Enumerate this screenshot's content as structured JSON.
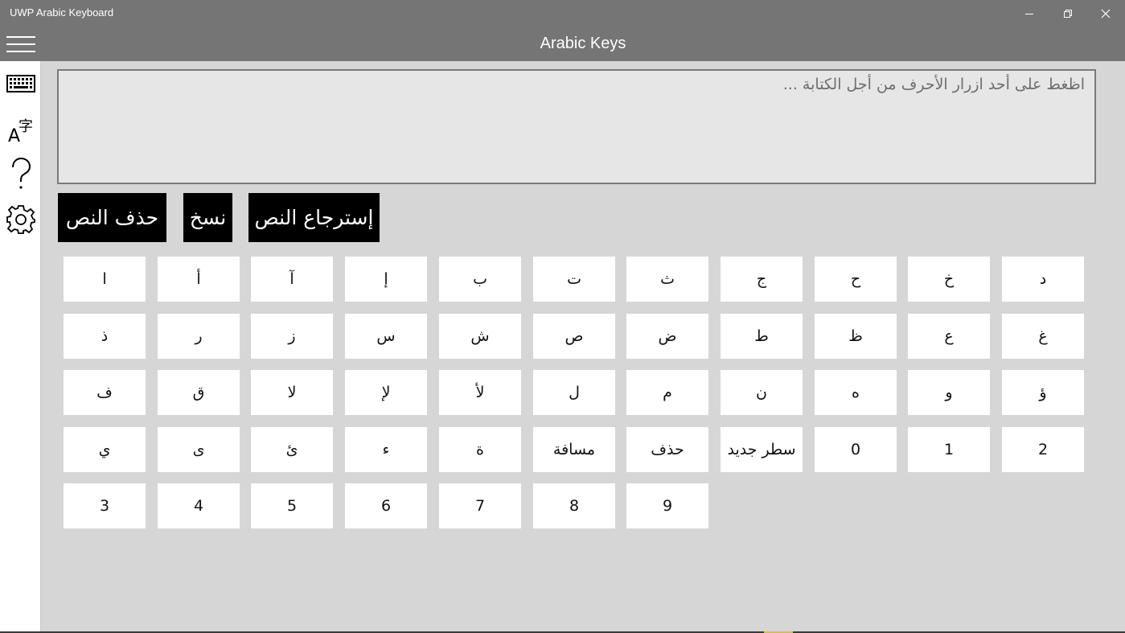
{
  "window": {
    "title": "UWP Arabic Keyboard",
    "controls": [
      "minimize-icon",
      "restore-icon",
      "close-icon"
    ]
  },
  "sidebar": {
    "items": [
      {
        "name": "hamburger-menu",
        "icon": "hamburger-icon"
      },
      {
        "name": "keyboard",
        "icon": "keyboard-icon"
      },
      {
        "name": "language",
        "icon": "translate-icon",
        "glyph": "字"
      },
      {
        "name": "help",
        "icon": "question-icon"
      },
      {
        "name": "settings",
        "icon": "gear-icon"
      }
    ]
  },
  "header": {
    "title": "Arabic Keys"
  },
  "editor": {
    "value": "",
    "placeholder": "اظغط على أحد ازرار الأحرف من أجل الكتابة ..."
  },
  "actions": {
    "clear": "حذف النص",
    "copy": "نسخ",
    "restore": "إسترجاع النص"
  },
  "keys": [
    [
      "ا",
      "أ",
      "آ",
      "إ",
      "ب",
      "ت",
      "ث",
      "ج",
      "ح",
      "خ",
      "د"
    ],
    [
      "ذ",
      "ر",
      "ز",
      "س",
      "ش",
      "ص",
      "ض",
      "ط",
      "ظ",
      "ع",
      "غ"
    ],
    [
      "ف",
      "ق",
      "لا",
      "لإ",
      "لأ",
      "ل",
      "م",
      "ن",
      "ه",
      "و",
      "ؤ"
    ],
    [
      "ي",
      "ى",
      "ئ",
      "ء",
      "ة",
      "مسافة",
      "حذف",
      "سطر جديد",
      "0",
      "1",
      "2"
    ],
    [
      "3",
      "4",
      "5",
      "6",
      "7",
      "8",
      "9"
    ]
  ],
  "colors": {
    "chrome": "#757575",
    "content_bg": "#d6d6d6",
    "action_bg": "#000000",
    "key_bg": "#ffffff"
  }
}
